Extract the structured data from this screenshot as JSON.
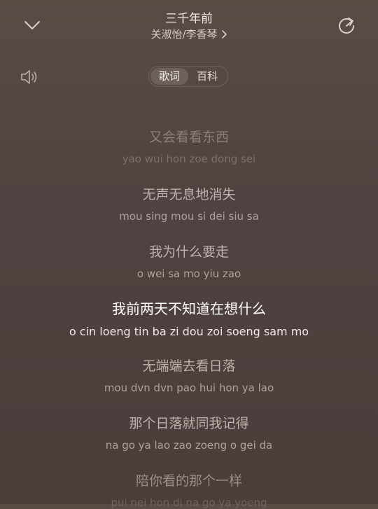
{
  "header": {
    "title": "三千年前",
    "artist": "关淑怡/李香琴"
  },
  "tabs": [
    {
      "label": "歌词",
      "active": true
    },
    {
      "label": "百科",
      "active": false
    }
  ],
  "lyrics": [
    {
      "cn": "又会看看东西",
      "rom": "yao wui hon zoe dong sei",
      "state": "dim"
    },
    {
      "cn": "无声无息地消失",
      "rom": "mou sing mou si dei siu sa",
      "state": "normal"
    },
    {
      "cn": "我为什么要走",
      "rom": "o wei sa mo yiu zao",
      "state": "normal"
    },
    {
      "cn": "我前两天不知道在想什么",
      "rom": "o cin loeng tin ba zi dou zoi soeng sam mo",
      "state": "active"
    },
    {
      "cn": "无端端去看日落",
      "rom": "mou dvn dvn pao hui hon ya lao",
      "state": "normal"
    },
    {
      "cn": "那个日落就同我记得",
      "rom": "na go ya lao zao zoeng o gei da",
      "state": "normal"
    },
    {
      "cn": "陪你看的那个一样",
      "rom": "pui nei hon di na go ya yoeng",
      "state": "faint"
    }
  ],
  "icons": {
    "back": "chevron-down-icon",
    "share": "share-refresh-icon",
    "speaker": "speaker-icon",
    "artist_arrow": "chevron-right-icon"
  },
  "colors": {
    "background_top": "#5a4b45",
    "background_bottom": "#4a3d3a",
    "active_text": "#ffffff"
  }
}
